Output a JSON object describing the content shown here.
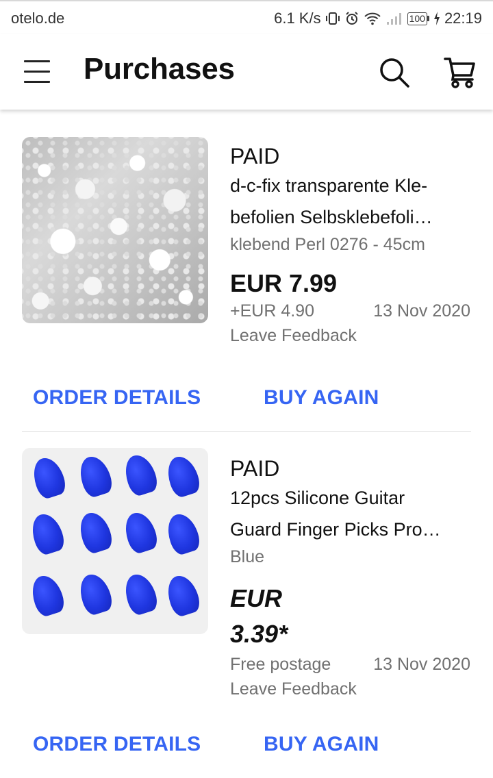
{
  "status_bar": {
    "carrier": "otelo.de",
    "speed": "6.1 K/s",
    "battery": "100",
    "time": "22:19"
  },
  "app_bar": {
    "title": "Purchases",
    "icons": [
      "menu-icon",
      "search-icon",
      "cart-icon"
    ]
  },
  "colors": {
    "accent": "#3665f3",
    "secondary_text": "#707070"
  },
  "orders": [
    {
      "status": "PAID",
      "title_line1": "d-c-fix transparente Kle-",
      "title_line2": "befolien Selbsklebefoli…",
      "variation": "klebend Perl 0276 - 45cm",
      "price": "EUR 7.99",
      "postage": "+EUR 4.90",
      "date": "13 Nov 2020",
      "feedback": "Leave Feedback",
      "order_details": "ORDER DETAILS",
      "buy_again": "BUY AGAIN"
    },
    {
      "status": "PAID",
      "title_line1": "12pcs Silicone Guitar",
      "title_line2": "Guard Finger Picks Pro…",
      "variation": "Blue",
      "price_line1": "EUR",
      "price_line2": "3.39*",
      "postage": "Free postage",
      "date": "13 Nov 2020",
      "feedback": "Leave Feedback",
      "order_details": "ORDER DETAILS",
      "buy_again": "BUY AGAIN"
    }
  ]
}
